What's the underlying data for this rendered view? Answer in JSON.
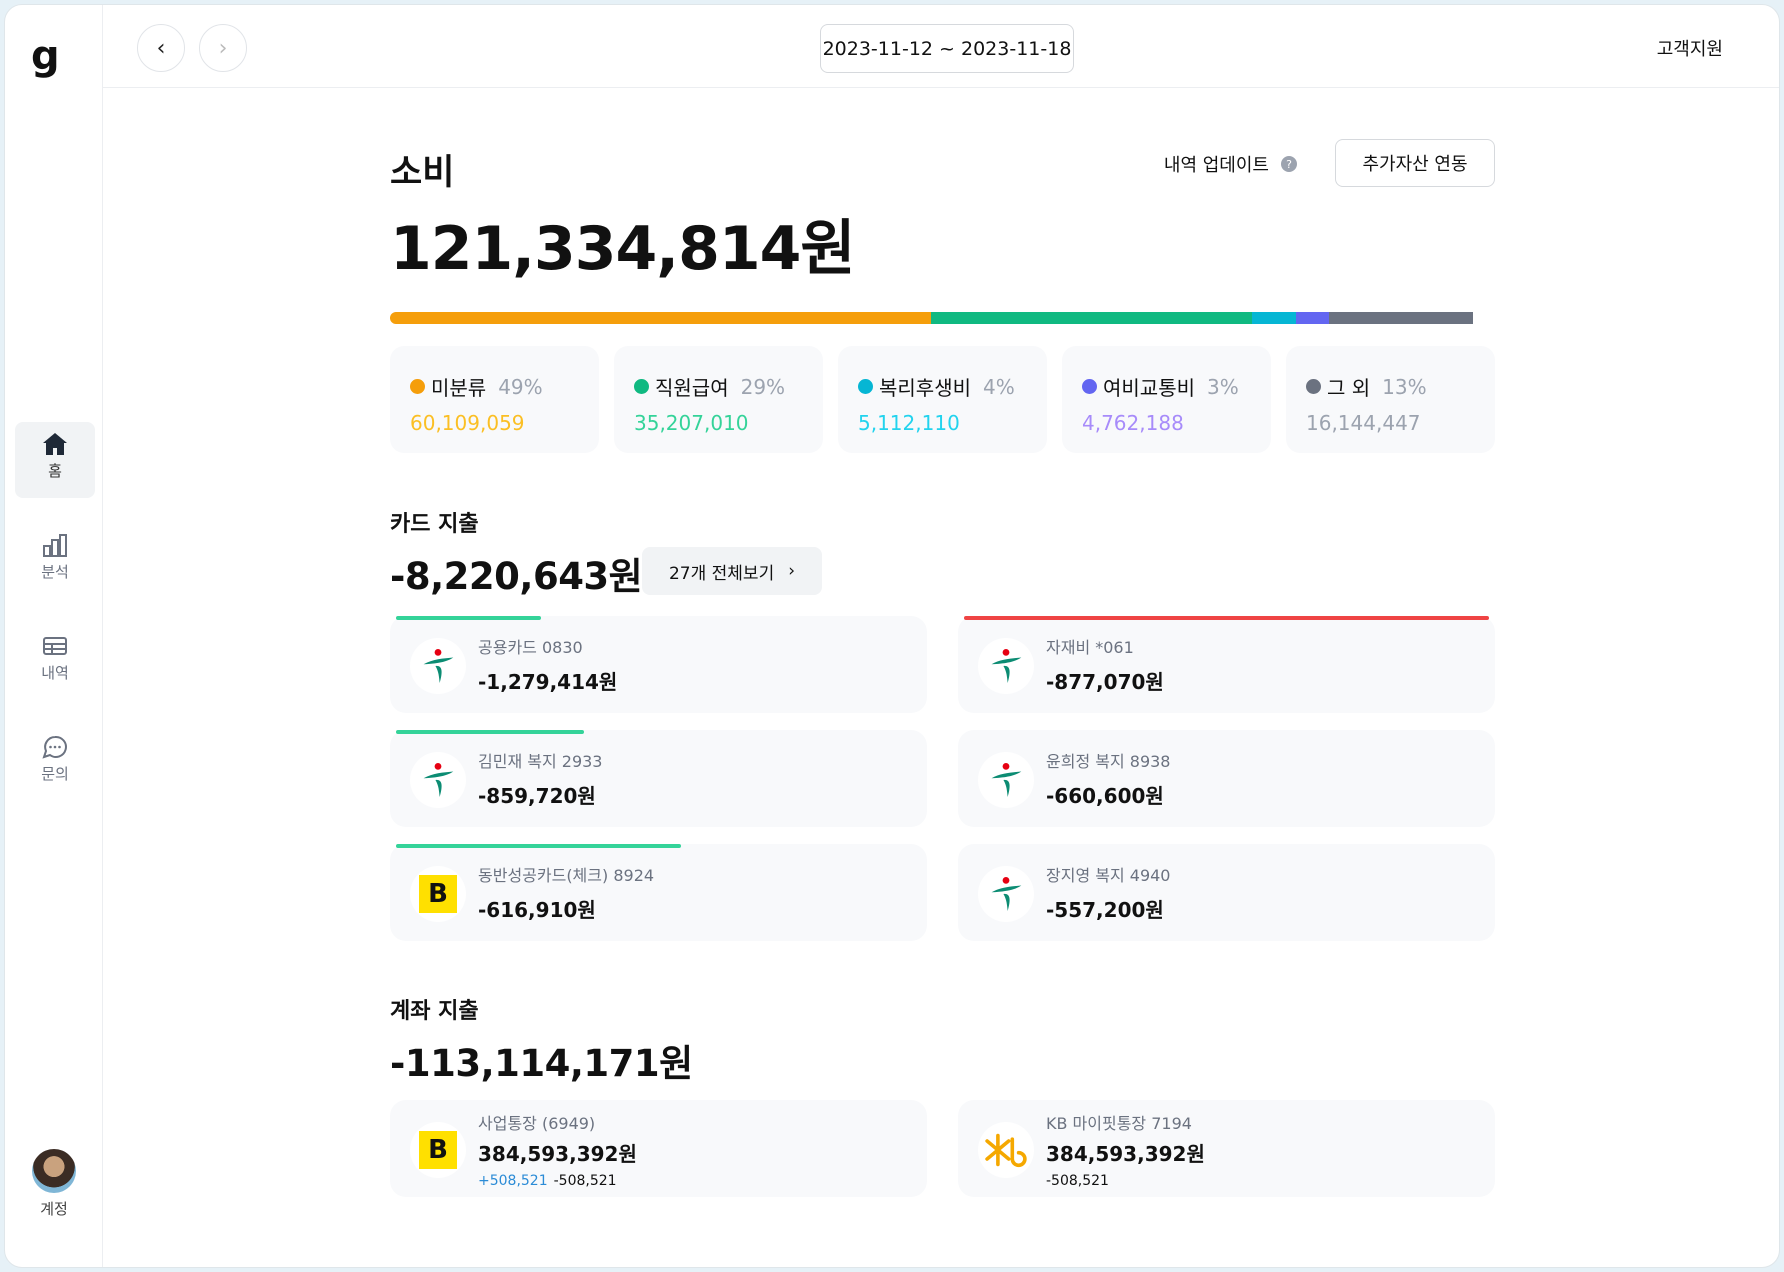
{
  "app": {
    "logo": "g"
  },
  "sidebar": {
    "items": [
      {
        "label": "홈"
      },
      {
        "label": "분석"
      },
      {
        "label": "내역"
      },
      {
        "label": "문의"
      }
    ],
    "account": "계정"
  },
  "topbar": {
    "date_range": "2023-11-12 ~ 2023-11-18",
    "support": "고객지원"
  },
  "spending": {
    "title": "소비",
    "total": "121,334,814원",
    "update_label": "내역 업데이트",
    "add_asset_label": "추가자산 연동",
    "categories": [
      {
        "name": "미분류",
        "percent": "49%",
        "amount": "60,109,059",
        "color": "#f59e0b",
        "value_color": "#fbbf24",
        "share": 49
      },
      {
        "name": "직원급여",
        "percent": "29%",
        "amount": "35,207,010",
        "color": "#10b981",
        "value_color": "#34d399",
        "share": 29
      },
      {
        "name": "복리후생비",
        "percent": "4%",
        "amount": "5,112,110",
        "color": "#06b6d4",
        "value_color": "#22d3ee",
        "share": 4
      },
      {
        "name": "여비교통비",
        "percent": "3%",
        "amount": "4,762,188",
        "color": "#6366f1",
        "value_color": "#a78bfa",
        "share": 3
      },
      {
        "name": "그 외",
        "percent": "13%",
        "amount": "16,144,447",
        "color": "#6b7280",
        "value_color": "#9ca3af",
        "share": 13
      }
    ]
  },
  "card_spending": {
    "title": "카드 지출",
    "total": "-8,220,643원",
    "view_all": "27개 전체보기",
    "cards": [
      {
        "name": "공용카드 0830",
        "amount": "-1,279,414원",
        "logo": "hana",
        "usage": 0.27,
        "bar": "green"
      },
      {
        "name": "자재비 *061",
        "amount": "-877,070원",
        "logo": "hana",
        "usage": 1.0,
        "bar": "red"
      },
      {
        "name": "김민재 복지 2933",
        "amount": "-859,720원",
        "logo": "hana",
        "usage": 0.35,
        "bar": "green"
      },
      {
        "name": "윤희정 복지 8938",
        "amount": "-660,600원",
        "logo": "hana",
        "usage": 0,
        "bar": "none"
      },
      {
        "name": "동반성공카드(체크) 8924",
        "amount": "-616,910원",
        "logo": "b",
        "usage": 0.53,
        "bar": "green"
      },
      {
        "name": "장지영 복지 4940",
        "amount": "-557,200원",
        "logo": "hana",
        "usage": 0,
        "bar": "none"
      }
    ]
  },
  "account_spending": {
    "title": "계좌 지출",
    "total": "-113,114,171원",
    "accounts": [
      {
        "name": "사업통장 (6949)",
        "balance": "384,593,392원",
        "in": "+508,521",
        "out": "-508,521",
        "logo": "b"
      },
      {
        "name": "KB 마이핏통장 7194",
        "balance": "384,593,392원",
        "out": "-508,521",
        "logo": "kb"
      }
    ]
  }
}
